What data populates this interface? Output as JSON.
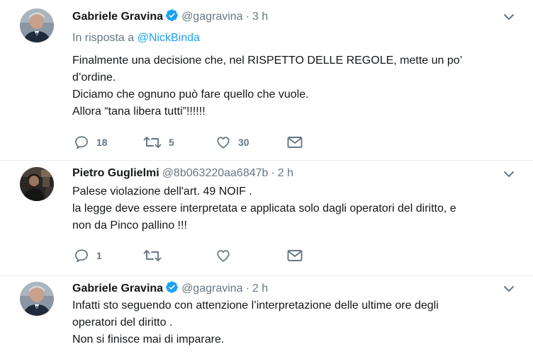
{
  "tweets": [
    {
      "author": "Gabriele Gravina",
      "handle": "@gagravina",
      "dot": "·",
      "time": "3 h",
      "verified": true,
      "reply_prefix": "In risposta a ",
      "reply_to": "@NickBinda",
      "lines": [
        "Finalmente una decisione che, nel RISPETTO DELLE REGOLE, mette un po’",
        "d’ordine.",
        "Diciamo che ognuno può fare quello che vuole.",
        "Allora “tana libera tutti”!!!!!!"
      ],
      "replies": "18",
      "retweets": "5",
      "likes": "30"
    },
    {
      "author": "Pietro Guglielmi",
      "handle": "@8b063220aa6847b",
      "dot": "·",
      "time": "2 h",
      "verified": false,
      "lines": [
        "Palese violazione dell'art. 49 NOIF .",
        "la legge deve essere interpretata e applicata solo dagli operatori del diritto, e",
        "non da Pinco pallino !!!"
      ],
      "replies": "1",
      "retweets": "",
      "likes": ""
    },
    {
      "author": "Gabriele Gravina",
      "handle": "@gagravina",
      "dot": "·",
      "time": "2 h",
      "verified": true,
      "lines": [
        "Infatti sto seguendo con attenzione l’interpretazione delle ultime ore degli",
        "operatori del diritto .",
        "Non si finisce mai di imparare."
      ]
    }
  ],
  "colors": {
    "name": "#14171a",
    "meta": "#657786",
    "link": "#1da1f2",
    "verified": "#1da1f2",
    "divider": "#e6ecf0"
  },
  "icons": [
    "verified-badge-icon",
    "chevron-down-icon",
    "reply-icon",
    "retweet-icon",
    "like-icon",
    "direct-message-icon"
  ]
}
